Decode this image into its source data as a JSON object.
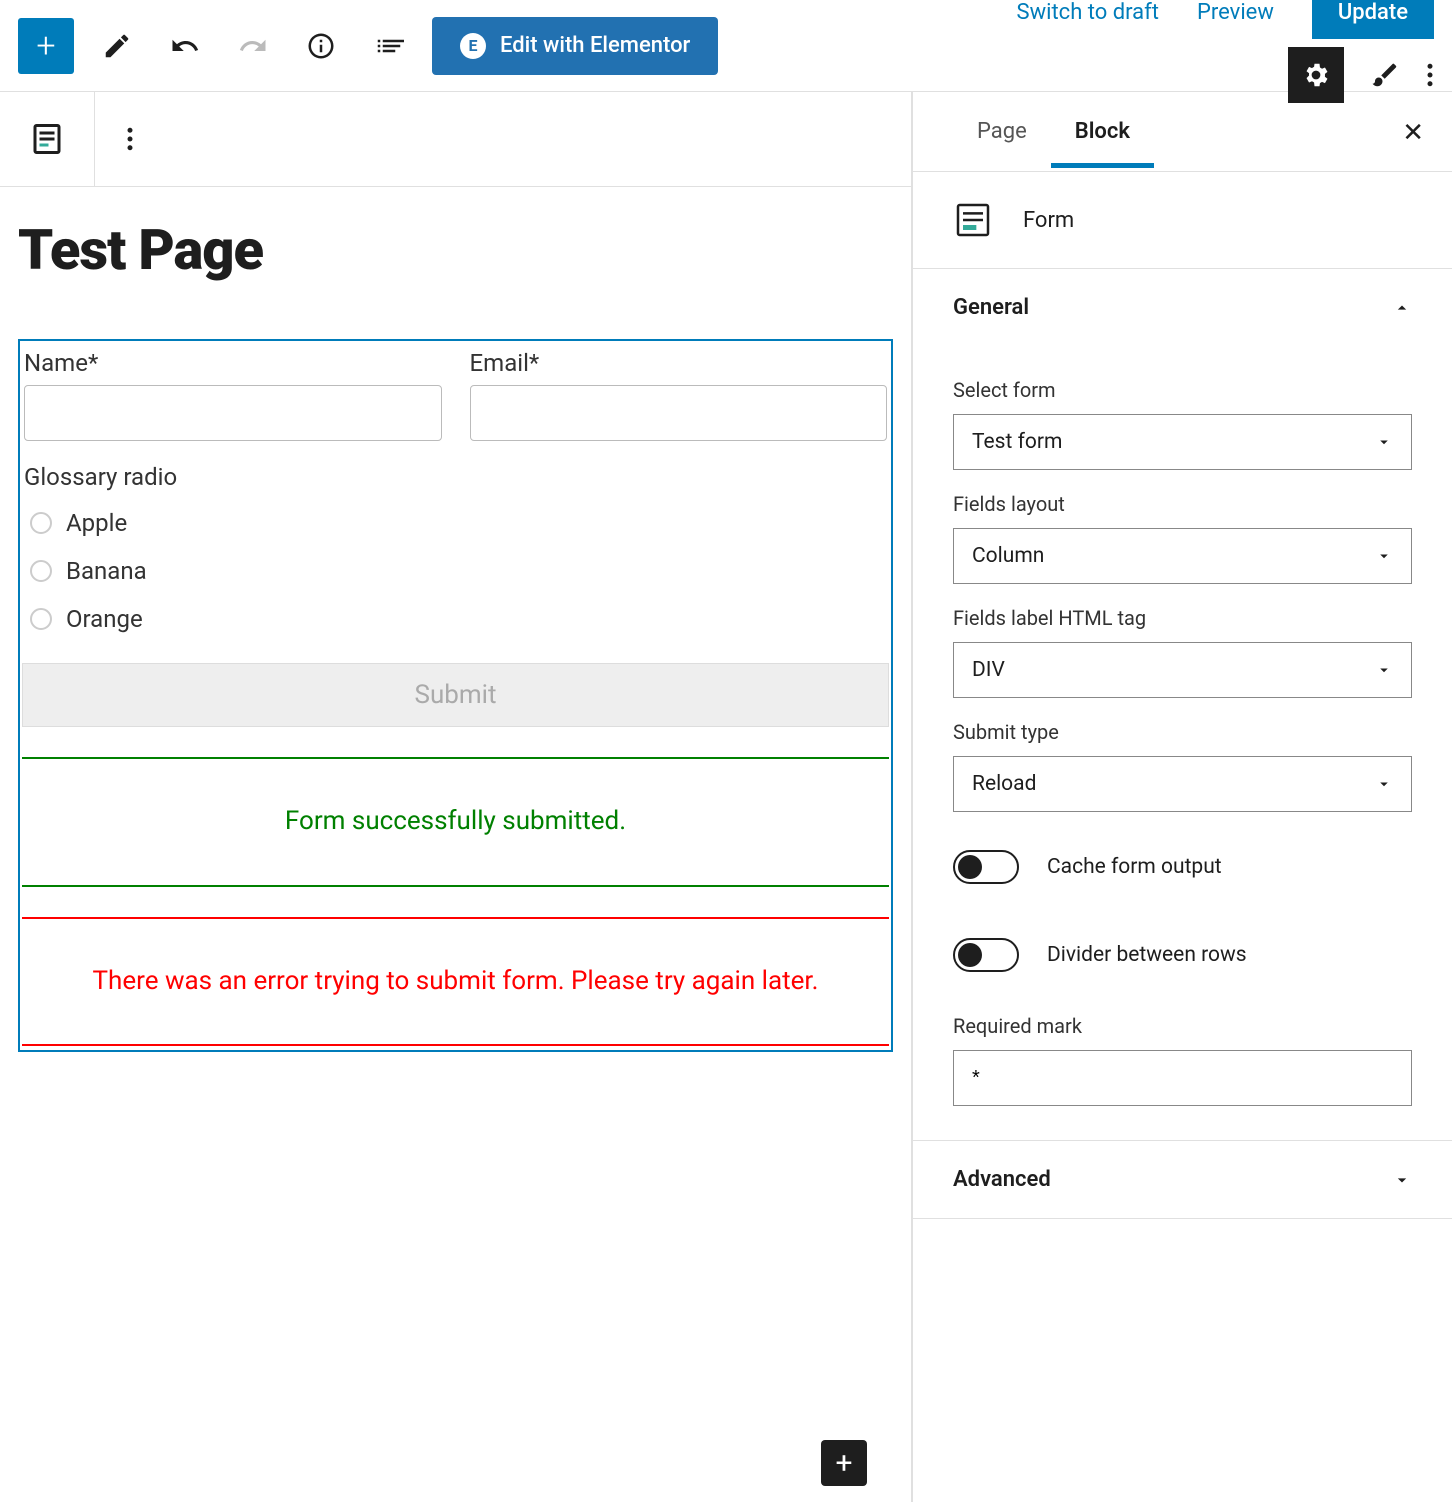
{
  "topbar": {
    "elementor_label": "Edit with Elementor",
    "switch_draft": "Switch to draft",
    "preview": "Preview",
    "update": "Update"
  },
  "editor": {
    "page_title": "Test Page",
    "form": {
      "field1_label": "Name*",
      "field2_label": "Email*",
      "radio_label": "Glossary radio",
      "radio_options": [
        "Apple",
        "Banana",
        "Orange"
      ],
      "submit_label": "Submit",
      "success_msg": "Form successfully submitted.",
      "error_msg": "There was an error trying to submit form. Please try again later."
    }
  },
  "sidebar": {
    "tabs": {
      "page": "Page",
      "block": "Block"
    },
    "block_name": "Form",
    "general": {
      "title": "General",
      "select_form": {
        "label": "Select form",
        "value": "Test form"
      },
      "fields_layout": {
        "label": "Fields layout",
        "value": "Column"
      },
      "label_tag": {
        "label": "Fields label HTML tag",
        "value": "DIV"
      },
      "submit_type": {
        "label": "Submit type",
        "value": "Reload"
      },
      "cache_toggle": "Cache form output",
      "divider_toggle": "Divider between rows",
      "required_mark": {
        "label": "Required mark",
        "value": "*"
      }
    },
    "advanced": {
      "title": "Advanced"
    }
  }
}
